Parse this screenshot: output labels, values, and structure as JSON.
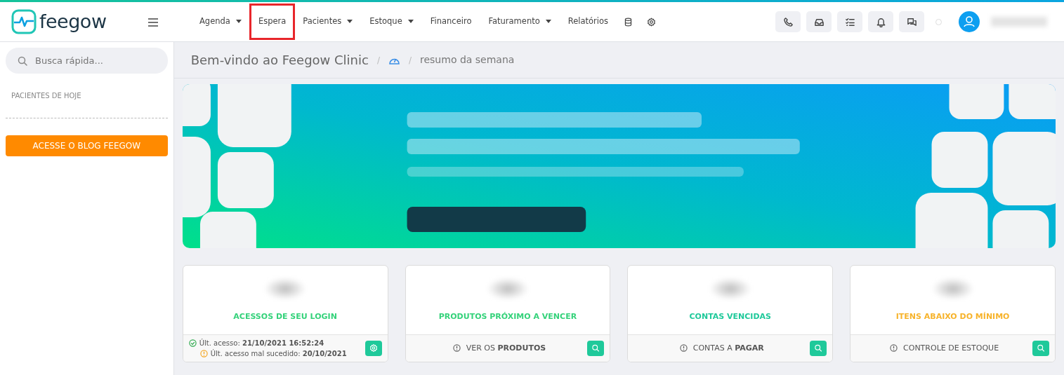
{
  "logo": {
    "text": "feegow"
  },
  "nav": [
    {
      "label": "Agenda",
      "dropdown": true,
      "highlighted": false
    },
    {
      "label": "Espera",
      "dropdown": false,
      "highlighted": true
    },
    {
      "label": "Pacientes",
      "dropdown": true,
      "highlighted": false
    },
    {
      "label": "Estoque",
      "dropdown": true,
      "highlighted": false
    },
    {
      "label": "Financeiro",
      "dropdown": false,
      "highlighted": false
    },
    {
      "label": "Faturamento",
      "dropdown": true,
      "highlighted": false
    },
    {
      "label": "Relatórios",
      "dropdown": false,
      "highlighted": false
    }
  ],
  "nav_icons": [
    {
      "kind": "database"
    },
    {
      "kind": "settings"
    }
  ],
  "toolbar": [
    {
      "kind": "phone"
    },
    {
      "kind": "inbox"
    },
    {
      "kind": "tasks"
    },
    {
      "kind": "bell"
    },
    {
      "kind": "chat"
    }
  ],
  "sidebar": {
    "search": {
      "placeholder": "Busca rápida..."
    },
    "section": "PACIENTES DE HOJE",
    "blog_button": "ACESSE O BLOG FEEGOW"
  },
  "breadcrumb": {
    "title": "Bem-vindo ao Feegow Clinic",
    "separators": [
      "/",
      "/"
    ],
    "current": "resumo da semana"
  },
  "cards": [
    {
      "title": "ACESSOS DE SEU LOGIN",
      "color": "#34d27a",
      "kind": "settings",
      "footer": [
        {
          "kind": "check",
          "text": "Últ. acesso: **21/10/2021 16:52:24**"
        },
        {
          "kind": "warning",
          "text": "Últ. acesso mal sucedido: **20/10/2021**"
        }
      ]
    },
    {
      "title": "PRODUTOS PRÓXIMO A VENCER",
      "color": "#34d27a",
      "kind": "search",
      "footer": [
        {
          "kind": "info",
          "text": "VER OS **PRODUTOS**"
        }
      ]
    },
    {
      "title": "CONTAS VENCIDAS",
      "color": "#1fc99a",
      "kind": "search",
      "footer": [
        {
          "kind": "info",
          "text": "CONTAS A **PAGAR**"
        }
      ]
    },
    {
      "title": "ITENS ABAIXO DO MÍNIMO",
      "color": "#f7b32b",
      "kind": "search",
      "footer": [
        {
          "kind": "info",
          "text": "CONTROLE DE ESTOQUE"
        }
      ]
    }
  ]
}
